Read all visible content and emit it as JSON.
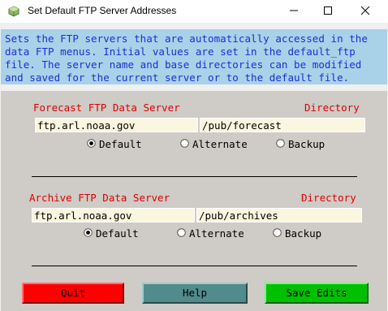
{
  "window": {
    "title": "Set Default FTP Server Addresses",
    "icon": "app-cube-icon"
  },
  "info": {
    "lines": [
      "Sets the FTP servers that are automatically accessed in the",
      "data FTP menus. Initial values are set in the default_ftp",
      "file. The server name and base directories can be modified",
      "and saved for the current server or to the default file."
    ]
  },
  "forecast": {
    "server_label": "Forecast FTP Data Server",
    "directory_label": "Directory",
    "server_value": "ftp.arl.noaa.gov",
    "directory_value": "/pub/forecast",
    "options": [
      "Default",
      "Alternate",
      "Backup"
    ],
    "selected": "Default"
  },
  "archive": {
    "server_label": "Archive FTP Data Server",
    "directory_label": "Directory",
    "server_value": "ftp.arl.noaa.gov",
    "directory_value": "/pub/archives",
    "options": [
      "Default",
      "Alternate",
      "Backup"
    ],
    "selected": "Default"
  },
  "buttons": {
    "quit": "Quit",
    "help": "Help",
    "save": "Save Edits"
  },
  "colors": {
    "info_bg": "#a9d1e8",
    "info_text": "#1a2fd6",
    "panel_bg": "#cfcbc6",
    "label_red": "#e00000",
    "quit": "#ff0000",
    "help": "#528b8b",
    "save": "#00c000"
  }
}
